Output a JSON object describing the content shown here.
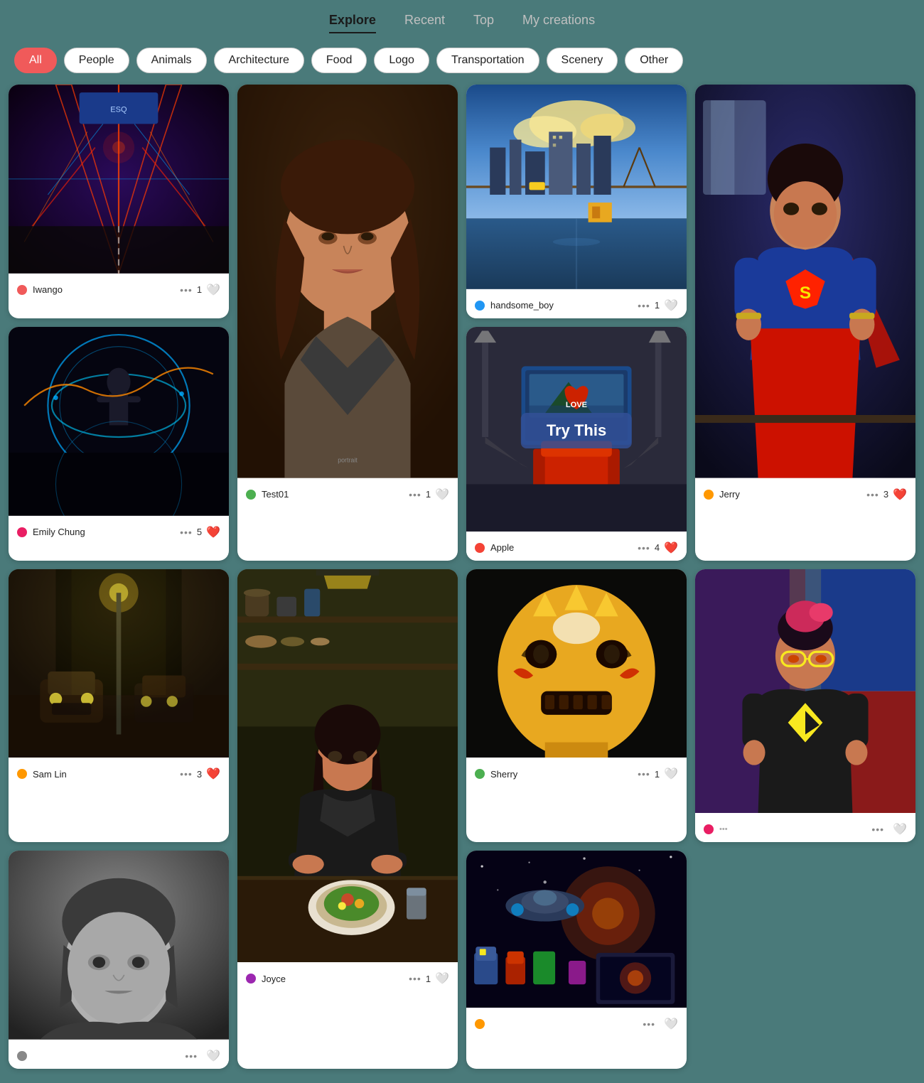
{
  "nav": {
    "items": [
      {
        "label": "Explore",
        "active": true
      },
      {
        "label": "Recent",
        "active": false
      },
      {
        "label": "Top",
        "active": false
      },
      {
        "label": "My creations",
        "active": false
      }
    ]
  },
  "filters": {
    "items": [
      {
        "label": "All",
        "active": true
      },
      {
        "label": "People",
        "active": false
      },
      {
        "label": "Animals",
        "active": false
      },
      {
        "label": "Architecture",
        "active": false
      },
      {
        "label": "Food",
        "active": false
      },
      {
        "label": "Logo",
        "active": false
      },
      {
        "label": "Transportation",
        "active": false
      },
      {
        "label": "Scenery",
        "active": false
      },
      {
        "label": "Other",
        "active": false
      }
    ]
  },
  "cards": [
    {
      "id": "card-1",
      "username": "Iwango",
      "avatar_color": "#f05a5a",
      "likes": 1,
      "dots": "...",
      "bg_type": "road",
      "tall": false
    },
    {
      "id": "card-2",
      "username": "Test01",
      "avatar_color": "#4caf50",
      "likes": 1,
      "dots": "...",
      "bg_type": "portrait_woman",
      "tall": true
    },
    {
      "id": "card-3",
      "username": "handsome_boy",
      "avatar_color": "#2196f3",
      "likes": 1,
      "dots": "...",
      "bg_type": "city",
      "tall": false
    },
    {
      "id": "card-4",
      "username": "Jerry",
      "avatar_color": "#ff9800",
      "likes": 3,
      "dots": "...",
      "bg_type": "superhero",
      "tall": true
    },
    {
      "id": "card-5",
      "username": "Emily Chung",
      "avatar_color": "#e91e63",
      "likes": 5,
      "dots": "...",
      "bg_type": "neon",
      "tall": false
    },
    {
      "id": "card-6",
      "username": "Apple",
      "avatar_color": "#f44336",
      "likes": 4,
      "dots": "...",
      "bg_type": "studio",
      "try_this": true,
      "try_this_label": "Try This",
      "tall": false
    },
    {
      "id": "card-7",
      "username": "Sam Lin",
      "avatar_color": "#ff9800",
      "likes": 3,
      "dots": "...",
      "bg_type": "alley",
      "tall": false
    },
    {
      "id": "card-8",
      "username": "Joyce",
      "avatar_color": "#9c27b0",
      "likes": 1,
      "dots": "...",
      "bg_type": "kitchen",
      "tall": true
    },
    {
      "id": "card-9",
      "username": "Sherry",
      "avatar_color": "#4caf50",
      "likes": 1,
      "dots": "...",
      "bg_type": "robot",
      "tall": false
    },
    {
      "id": "card-10",
      "username": "",
      "avatar_color": "#e91e63",
      "likes": 0,
      "dots": "...",
      "bg_type": "hero2",
      "tall": false
    },
    {
      "id": "card-11",
      "username": "",
      "avatar_color": "#888",
      "likes": 0,
      "dots": "...",
      "bg_type": "bw_portrait",
      "tall": false
    },
    {
      "id": "card-12",
      "username": "",
      "avatar_color": "#ff9800",
      "likes": 0,
      "dots": "...",
      "bg_type": "space",
      "tall": false
    }
  ]
}
